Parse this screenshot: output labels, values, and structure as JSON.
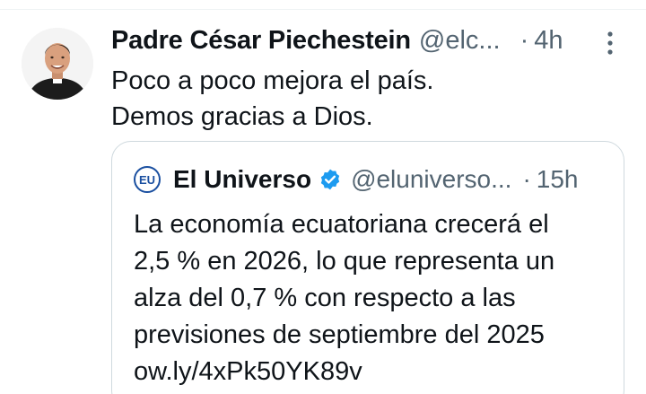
{
  "tweet": {
    "author_name": "Padre César Piechestein",
    "author_handle": "@elc...",
    "separator": "·",
    "time": "4h",
    "text_lines": [
      "Poco a poco mejora el país.",
      "Demos gracias a Dios."
    ]
  },
  "quote": {
    "logo_text": "EU",
    "author_name": "El Universo",
    "author_handle": "@eluniverso...",
    "separator": "·",
    "time": "15h",
    "text_lines": [
      "La economía ecuatoriana crecerá el",
      "2,5 % en 2026, lo que representa un",
      "alza del 0,7 % con respecto a las",
      "previsiones de septiembre del 2025",
      "ow.ly/4xPk50YK89v"
    ]
  },
  "icons": {
    "more": "more-vertical-icon",
    "verified": "verified-badge-icon"
  },
  "colors": {
    "text_primary": "#0f1419",
    "text_secondary": "#536471",
    "verified_blue": "#1d9bf0",
    "border": "#cfd9de"
  }
}
